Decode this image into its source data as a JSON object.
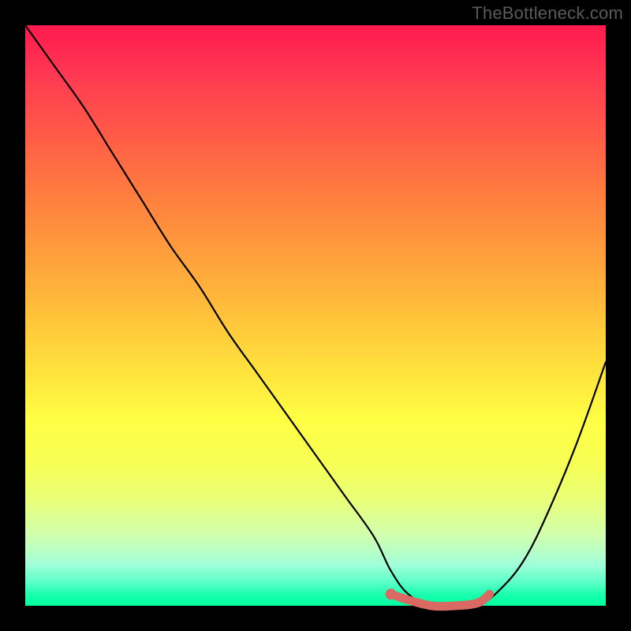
{
  "watermark": "TheBottleneck.com",
  "chart_data": {
    "type": "line",
    "title": "",
    "xlabel": "",
    "ylabel": "",
    "xlim": [
      0,
      100
    ],
    "ylim": [
      0,
      100
    ],
    "series": [
      {
        "name": "bottleneck-curve",
        "x": [
          0,
          5,
          10,
          15,
          20,
          25,
          30,
          35,
          40,
          45,
          50,
          55,
          60,
          63,
          66,
          70,
          74,
          78,
          82,
          86,
          90,
          95,
          100
        ],
        "values": [
          100,
          93,
          86,
          78,
          70,
          62,
          55,
          47,
          40,
          33,
          26,
          19,
          12,
          6,
          2,
          0,
          0,
          0,
          3,
          8,
          16,
          28,
          42
        ]
      }
    ],
    "highlight": {
      "name": "optimal-range",
      "x": [
        63,
        66,
        70,
        74,
        78,
        80
      ],
      "values": [
        2,
        1,
        0,
        0,
        0.5,
        2
      ],
      "color": "#d86a63"
    },
    "gradient_stops": [
      {
        "pos": 0,
        "color": "#ff1a4f"
      },
      {
        "pos": 50,
        "color": "#ffdd3c"
      },
      {
        "pos": 100,
        "color": "#00ff9e"
      }
    ]
  }
}
